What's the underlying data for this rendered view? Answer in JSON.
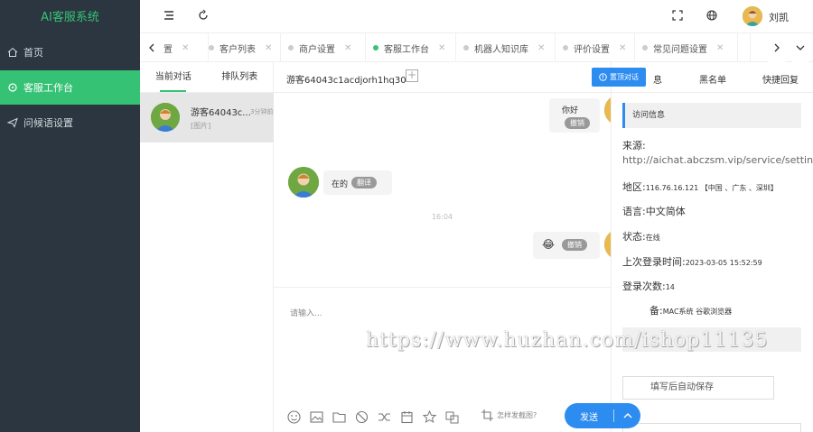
{
  "app": {
    "brand": "AI客服系统"
  },
  "sidebar": {
    "items": [
      {
        "label": "首页",
        "icon": "home-icon"
      },
      {
        "label": "客服工作台",
        "icon": "chat-icon",
        "active": true
      },
      {
        "label": "问候语设置",
        "icon": "send-icon"
      }
    ]
  },
  "header": {
    "user_name": "刘凯"
  },
  "tabs": [
    {
      "label": "置"
    },
    {
      "label": "客户列表"
    },
    {
      "label": "商户设置"
    },
    {
      "label": "客服工作台",
      "active": true
    },
    {
      "label": "机器人知识库"
    },
    {
      "label": "评价设置"
    },
    {
      "label": "常见问题设置"
    }
  ],
  "conversations": {
    "tabs": [
      "当前对话",
      "排队列表"
    ],
    "items": [
      {
        "name": "游客64043c...",
        "time": "3分钟前",
        "preview": "[图片]"
      }
    ]
  },
  "chat": {
    "title": "游客64043c1acdjorh1hq30",
    "pin_label": "置顶对话",
    "messages": [
      {
        "side": "right",
        "text": "你好",
        "badge": "撤销"
      },
      {
        "side": "left",
        "text": "在的",
        "badge": "翻译"
      },
      {
        "side": "time",
        "text": "16:04"
      },
      {
        "side": "right",
        "text": "😂",
        "badge": "撤销"
      }
    ],
    "input_placeholder": "请输入...",
    "screenshot_hint": "怎样发截图?",
    "send_label": "发送"
  },
  "right_panel": {
    "tabs": [
      "息",
      "黑名单",
      "快捷回复"
    ],
    "section_title": "访问信息",
    "source_label": "来源:",
    "source_value": "http://aichat.abczsm.vip/service/setting/ad",
    "region_label": "地区:",
    "region_value": "116.76.16.121 【中国 、广东 、深圳】",
    "language_label": "语言:",
    "language_value": "中文简体",
    "status_label": "状态:",
    "status_value": "在线",
    "last_login_label": "上次登录时间:",
    "last_login_value": "2023-03-05 15:52:59",
    "login_count_label": "登录次数:",
    "login_count_value": "14",
    "device_label": "备:",
    "device_value": "MAC系统 谷歌浏览器",
    "note_text": "填写后自动保存"
  },
  "watermark": "https://www.huzhan.com/ishop11135",
  "colors": {
    "brand_green": "#36c274",
    "sidebar_bg": "#2b3640",
    "primary_blue": "#2d8cf0"
  }
}
